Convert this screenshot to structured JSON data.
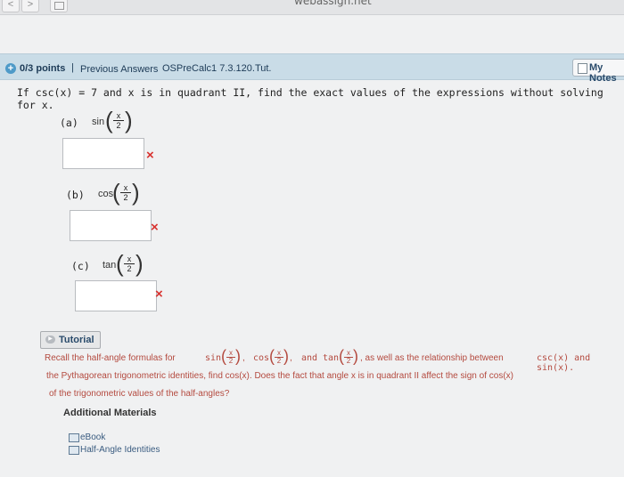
{
  "browser": {
    "back": "<",
    "forward": ">",
    "url": "webassign.net"
  },
  "header": {
    "points": "0/3 points",
    "separator": "|",
    "previous_answers": "Previous Answers",
    "source": "OSPreCalc1 7.3.120.Tut.",
    "my_notes": "My Notes"
  },
  "question": {
    "text": "If csc(x) = 7 and x is in quadrant II, find the exact values of the expressions without solving for x.",
    "parts": [
      {
        "label": "(a)",
        "fn": "sin",
        "num": "x",
        "den": "2",
        "answer": "",
        "status": "×"
      },
      {
        "label": "(b)",
        "fn": "cos",
        "num": "x",
        "den": "2",
        "answer": "",
        "status": "×"
      },
      {
        "label": "(c)",
        "fn": "tan",
        "num": "x",
        "den": "2",
        "answer": "",
        "status": "×"
      }
    ]
  },
  "tutorial": {
    "button": "Tutorial",
    "line1_a": "Recall the half-angle formulas for",
    "fn_sin": "sin",
    "fn_cos": "cos",
    "fn_tan": "tan",
    "comma1": ",",
    "and": "and",
    "line1_b": ", as well as the relationship between",
    "rel": "csc(x) and sin(x).",
    "line2": "the Pythagorean trigonometric identities, find cos(x). Does the fact that angle x is in quadrant II affect the sign of cos(x)",
    "line3": "of the trigonometric values of the half-angles?",
    "frac_num": "x",
    "frac_den": "2"
  },
  "additional": {
    "title": "Additional Materials",
    "items": [
      "eBook",
      "Half-Angle Identities"
    ]
  }
}
